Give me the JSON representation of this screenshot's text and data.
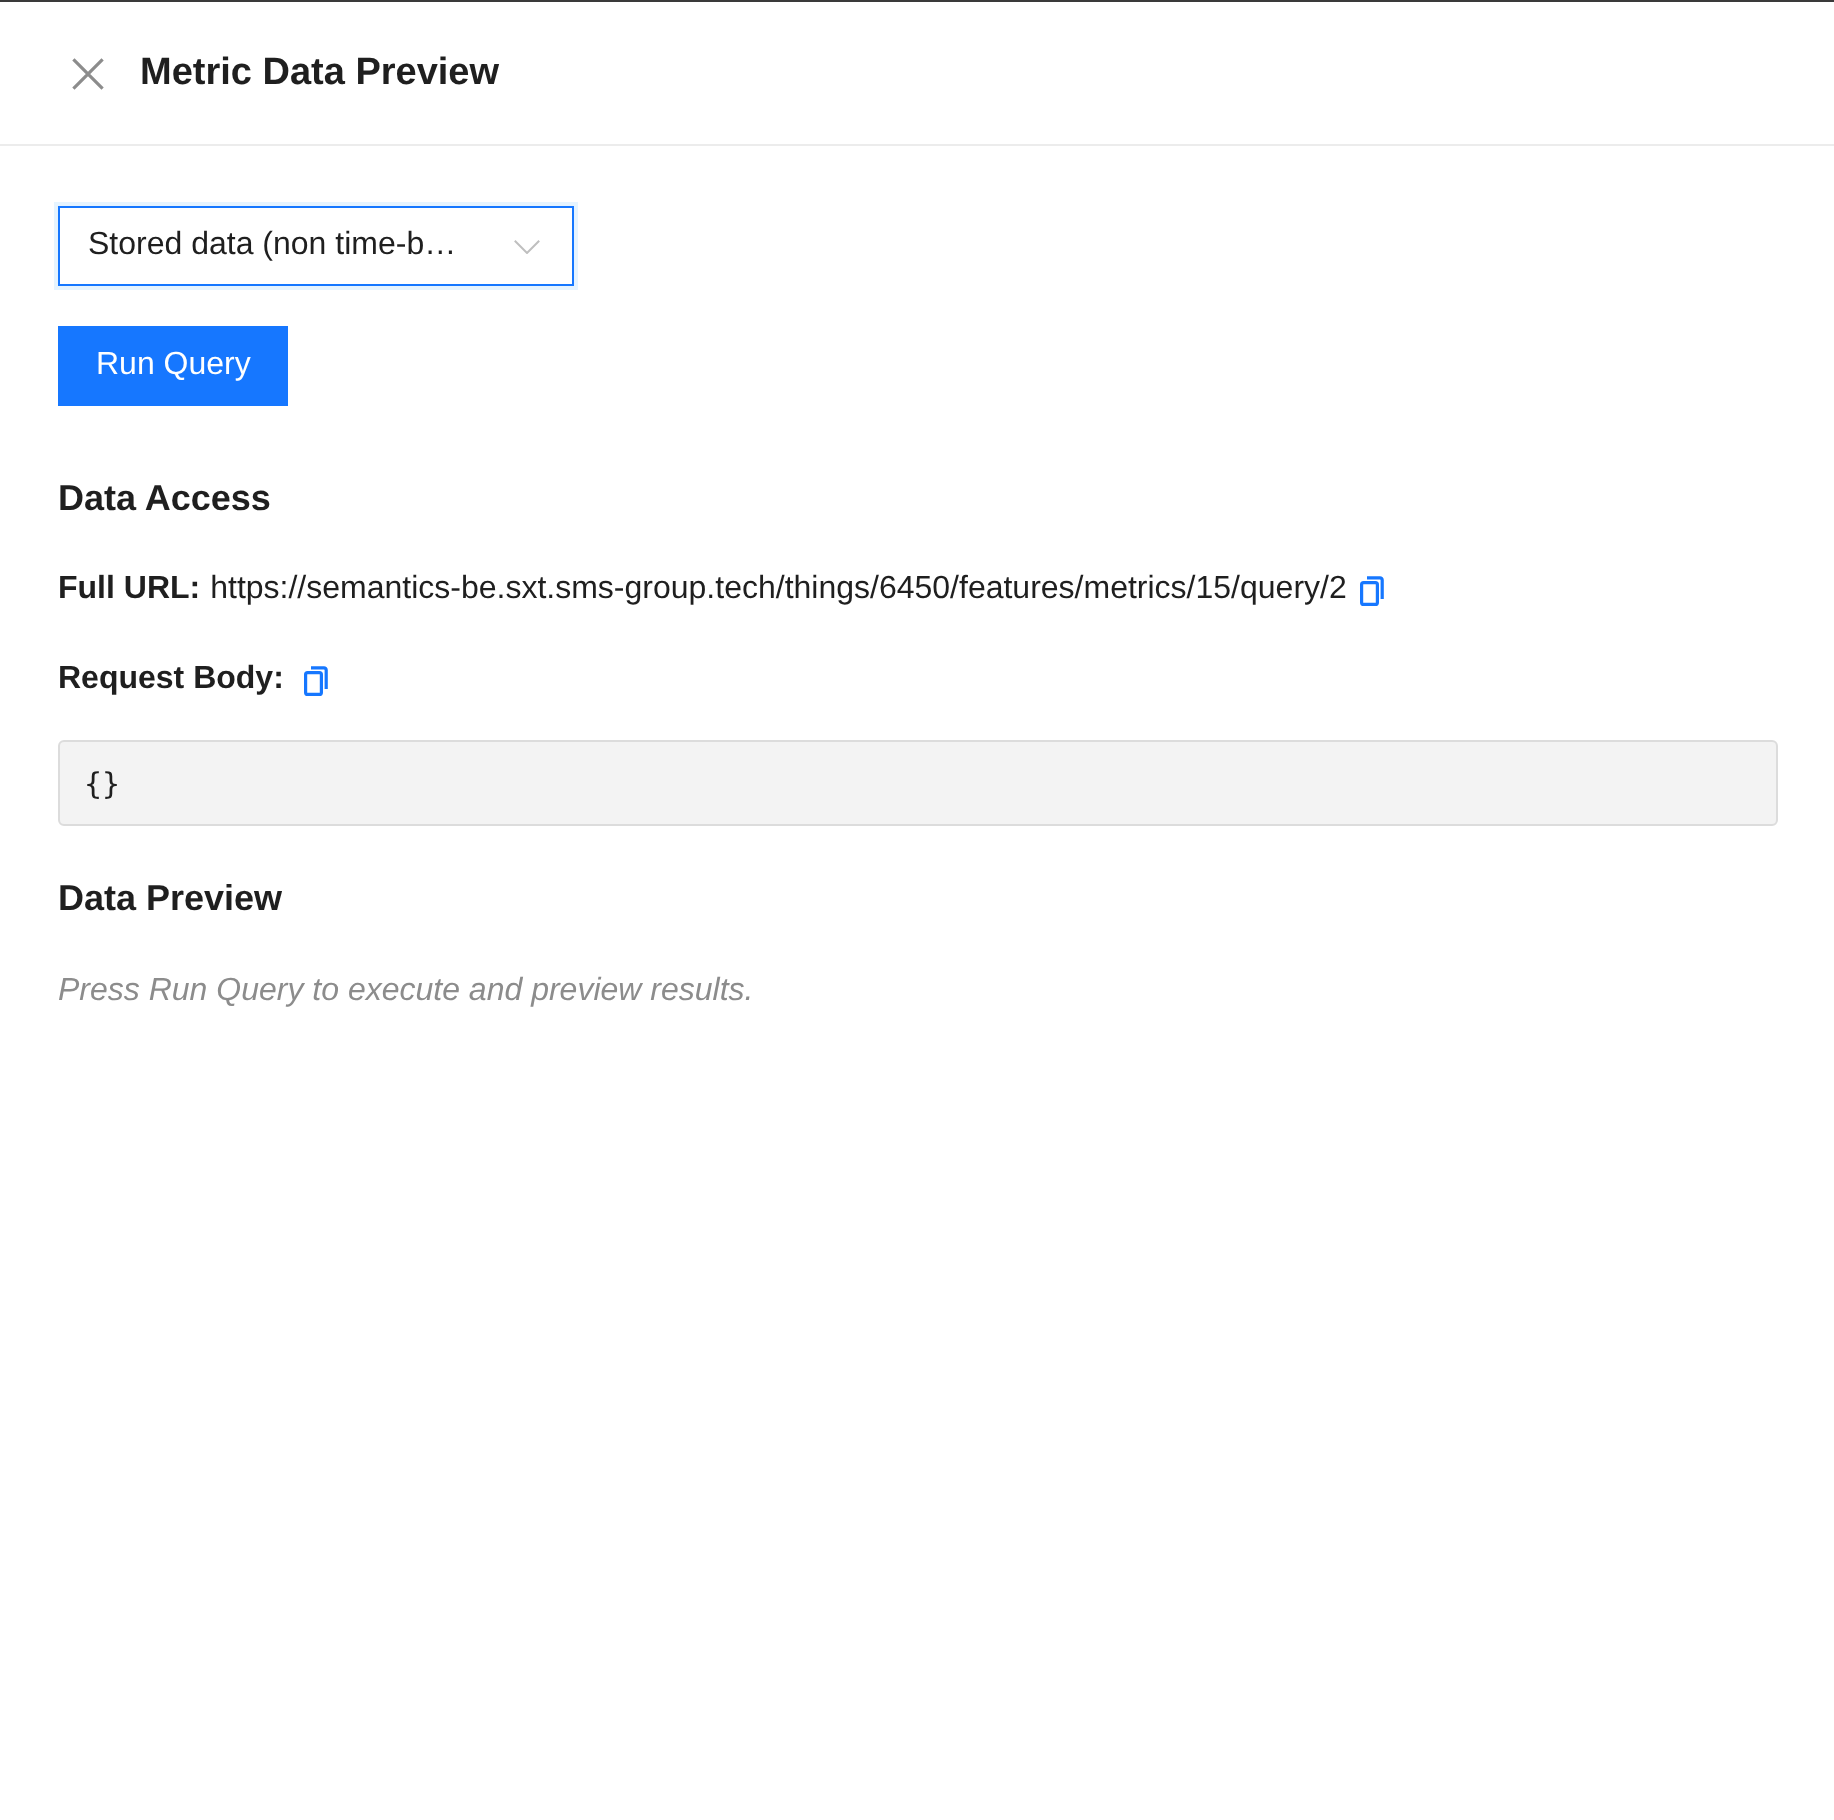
{
  "header": {
    "title": "Metric Data Preview"
  },
  "query_type_select": {
    "value": "Stored data (non time-b…",
    "focused": true
  },
  "run_button": {
    "label": "Run Query"
  },
  "data_access": {
    "heading": "Data Access",
    "full_url": {
      "label": "Full URL:",
      "value": "https://semantics-be.sxt.sms-group.tech/things/6450/features/metrics/15/query/2"
    },
    "request_body": {
      "label": "Request Body:",
      "value": "{}"
    }
  },
  "data_preview": {
    "heading": "Data Preview",
    "empty_message": "Press Run Query to execute and preview results."
  }
}
